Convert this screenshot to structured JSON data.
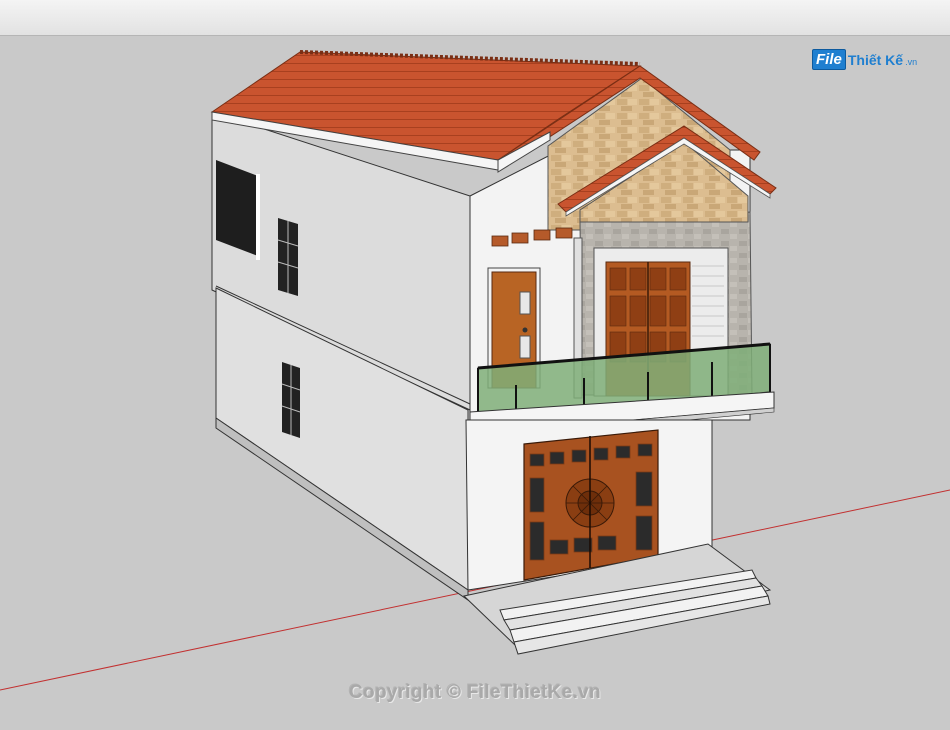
{
  "watermark": {
    "logo_prefix": "File",
    "logo_text": "Thiết Kế",
    "logo_domain": ".vn"
  },
  "copyright": "Copyright © FileThietKe.vn",
  "colors": {
    "roof": "#c9542f",
    "wall": "#f2f2f2",
    "side_wall": "#dcdcdc",
    "stone": "#d9b98a",
    "glass": "#7fae78",
    "door": "#b85d22",
    "axis_red": "#c23030",
    "logo_blue": "#1f7fd0"
  },
  "icons": {
    "logo": "filethietke-logo-icon"
  }
}
